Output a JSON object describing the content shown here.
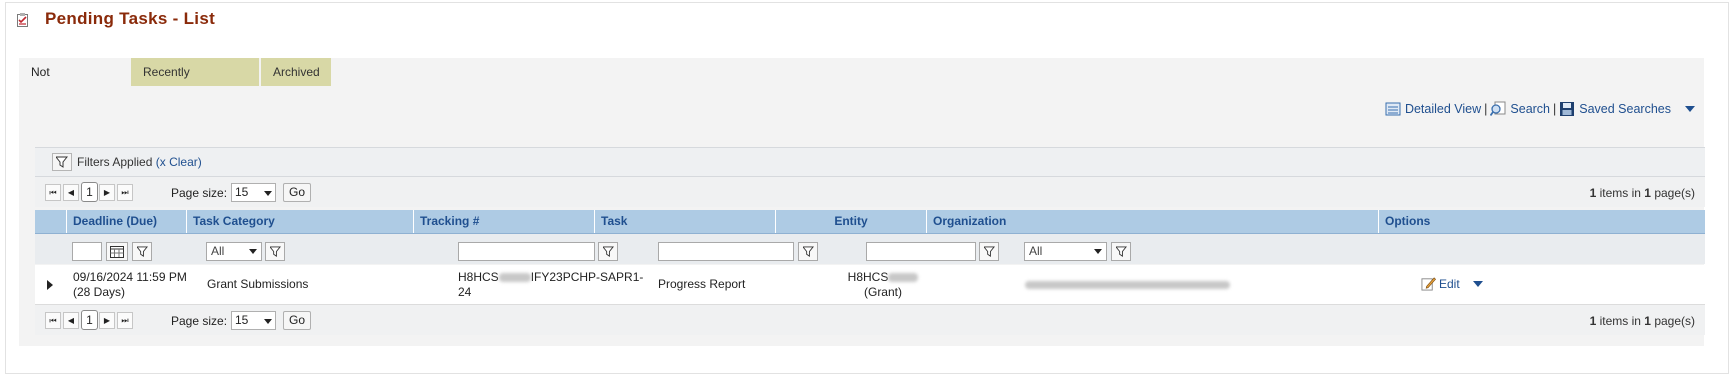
{
  "page": {
    "title": "Pending Tasks - List"
  },
  "tabs": [
    {
      "label": "Not Completed",
      "active": true
    },
    {
      "label": "Recently Completed",
      "active": false
    },
    {
      "label": "Archived",
      "active": false
    }
  ],
  "toolbar": {
    "detailed_view": "Detailed View",
    "search": "Search",
    "saved_searches": "Saved Searches",
    "separator": "|"
  },
  "filters": {
    "applied_label": "Filters Applied",
    "clear_prefix": "(x",
    "clear_label": "Clear)"
  },
  "pager": {
    "page_size_label": "Page size:",
    "page_size": "15",
    "go_label": "Go",
    "current_page": "1",
    "items_count": "1",
    "items_label": "items in",
    "page_count": "1",
    "pages_label": "page(s)"
  },
  "columns": [
    "Deadline (Due)",
    "Task Category",
    "Tracking #",
    "Task",
    "Entity",
    "Organization",
    "Options"
  ],
  "filter_row": {
    "category_select": "All",
    "organization_select": "All"
  },
  "row": {
    "deadline": "09/16/2024 11:59 PM",
    "deadline_days": "(28 Days)",
    "category": "Grant Submissions",
    "tracking_prefix": "H8HCS",
    "tracking_suffix": "IFY23PCHP-SAPR1-",
    "tracking_line2": "24",
    "task": "Progress Report",
    "entity_prefix": "H8HCS",
    "entity_type": "(Grant)",
    "edit_label": "Edit"
  },
  "colors": {
    "title": "#8a2a0a",
    "link": "#1f4f8f",
    "header_bg": "#aecbe4",
    "tab_inactive": "#d8d8a6"
  }
}
